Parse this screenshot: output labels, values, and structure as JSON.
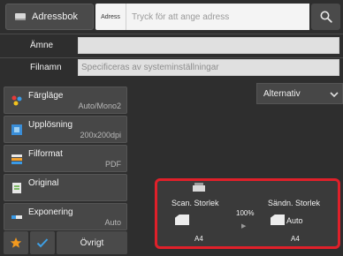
{
  "header": {
    "address_book_label": "Adressbok",
    "address_tag": "Adress",
    "address_placeholder": "Tryck för att ange adress"
  },
  "fields": {
    "subject_label": "Ämne",
    "subject_value": "",
    "filename_label": "Filnamn",
    "filename_placeholder": "Specificeras av systeminställningar"
  },
  "settings": [
    {
      "label": "Färgläge",
      "value": "Auto/Mono2"
    },
    {
      "label": "Upplösning",
      "value": "200x200dpi"
    },
    {
      "label": "Filformat",
      "value": "PDF"
    },
    {
      "label": "Original",
      "value": ""
    },
    {
      "label": "Exponering",
      "value": "Auto"
    }
  ],
  "alternativ_label": "Alternativ",
  "bottom": {
    "other_label": "Övrigt"
  },
  "scan_panel": {
    "scan_size_label": "Scan. Storlek",
    "send_size_label": "Sändn. Storlek",
    "ratio": "100%",
    "send_size_value": "Auto",
    "scan_paper": "A4",
    "send_paper": "A4"
  },
  "colors": {
    "accent_red": "#e0202a",
    "star_orange": "#f39a1e",
    "check_blue": "#3ea0e6"
  }
}
